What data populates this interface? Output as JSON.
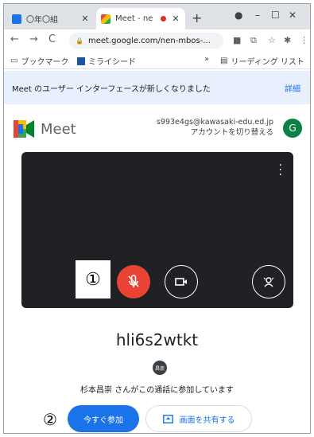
{
  "browser": {
    "tabs": [
      {
        "title": "〇年〇組",
        "favicon_color": "#1a73e8"
      },
      {
        "title": "Meet - ne",
        "favicon_color": "#ea4335",
        "recording": true
      }
    ],
    "url": "meet.google.com/nen-mbos-...",
    "bookmarks": [
      {
        "icon": "bookmark-folder-icon",
        "label": "ブックマーク"
      },
      {
        "icon": "mirai-seed-icon",
        "label": "ミライシード"
      }
    ],
    "bookmarks_more": "»",
    "reading_list": "リーディング リスト"
  },
  "banner": {
    "text": "Meet のユーザー インターフェースが新しくなりました",
    "link": "詳細"
  },
  "header": {
    "brand": "Meet",
    "account_email": "s993e4gs@kawasaki-edu.ed.jp",
    "switch_account": "アカウントを切り替える",
    "avatar_letter": "G"
  },
  "preview": {
    "marker1": "①"
  },
  "meeting": {
    "code": "hli6s2wtkt",
    "participant_initials": "昌崇",
    "status": "杉本昌崇 さんがこの通話に参加しています",
    "join_label": "今すぐ参加",
    "share_label": "画面を共有する",
    "marker2": "②"
  },
  "colors": {
    "accent": "#1a73e8",
    "mic_off": "#ea4335",
    "avatar": "#0b8043"
  }
}
